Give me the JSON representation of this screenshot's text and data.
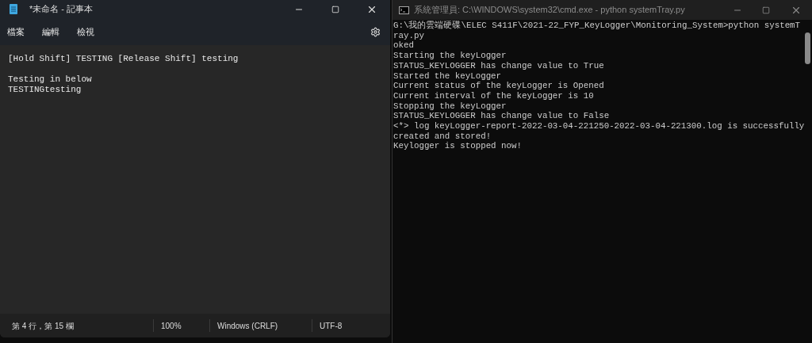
{
  "notepad": {
    "title": "*未命名 - 記事本",
    "menu": [
      "檔案",
      "編輯",
      "檢視"
    ],
    "paragraphs": [
      {
        "lines": [
          "[Hold Shift] TESTING [Release Shift] testing"
        ]
      },
      {
        "lines": [
          "Testing in below",
          "TESTINGtesting"
        ]
      }
    ],
    "status_bar": [
      "第 4 行，第 15 欄",
      "100%",
      "Windows (CRLF)",
      "UTF-8"
    ]
  },
  "terminal": {
    "title": "系統管理員: C:\\WINDOWS\\system32\\cmd.exe - python  systemTray.py",
    "lines": [
      "G:\\我的雲端硬碟\\ELEC S411F\\2021-22_FYP_KeyLogger\\Monitoring_System>python systemT",
      "ray.py",
      "oked",
      "Starting the keyLogger",
      "STATUS_KEYLOGGER has change value to True",
      "Started the keyLogger",
      "Current status of the keyLogger is Opened",
      "Current interval of the keyLogger is 10",
      "Stopping the keyLogger",
      "STATUS_KEYLOGGER has change value to False",
      "<*> log keyLogger-report-2022-03-04-221250-2022-03-04-221300.log is successfully",
      "created and stored!",
      "Keylogger is stopped now!"
    ]
  }
}
